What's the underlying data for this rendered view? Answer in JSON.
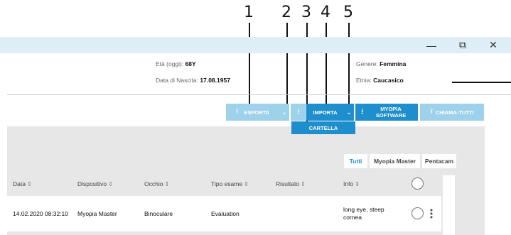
{
  "callouts": [
    "1",
    "2",
    "3",
    "4",
    "5"
  ],
  "window": {
    "minimize": "—",
    "restore": "⧉",
    "close": "✕"
  },
  "patient": {
    "age_label": "Età (oggi): ",
    "age_value": "68Y",
    "dob_label": "Data di Nascita: ",
    "dob_value": "17.08.1957",
    "gender_label": "Genere: ",
    "gender_value": "Femmina",
    "ethnicity_label": "Etnia: ",
    "ethnicity_value": "Caucasico"
  },
  "toolbar": {
    "export_label": "ESPORTA",
    "import_label": "IMPORTA",
    "myopia_line1": "MYOPIA",
    "myopia_line2": "SOFTWARE",
    "callall_label": "CHIAMA-TUTTI",
    "folder_label": "CARTELLA"
  },
  "tabs": [
    {
      "label": "Tutti",
      "active": true
    },
    {
      "label": "Myopia Master",
      "active": false
    },
    {
      "label": "Pentacam",
      "active": false
    }
  ],
  "table": {
    "columns": [
      "Data",
      "Dispositivo",
      "Occhio",
      "Tipo esame",
      "Risultato",
      "Info"
    ],
    "rows": [
      {
        "data": "14.02.2020 08:32:10",
        "dispositivo": "Myopia Master",
        "occhio": "Binoculare",
        "tipo": "Evaluation",
        "risultato": "",
        "info_line1": "long eye, steep",
        "info_line2": "cornea"
      }
    ]
  },
  "colors": {
    "accent": "#1f8ecc",
    "accent_light": "#9dd2ea",
    "titlebar": "#ddeef6",
    "panel": "#e7e7e7"
  },
  "icons": [
    "upload-icon",
    "download-icon",
    "chevron-down-icon",
    "sort-icon",
    "more-vertical-icon"
  ]
}
